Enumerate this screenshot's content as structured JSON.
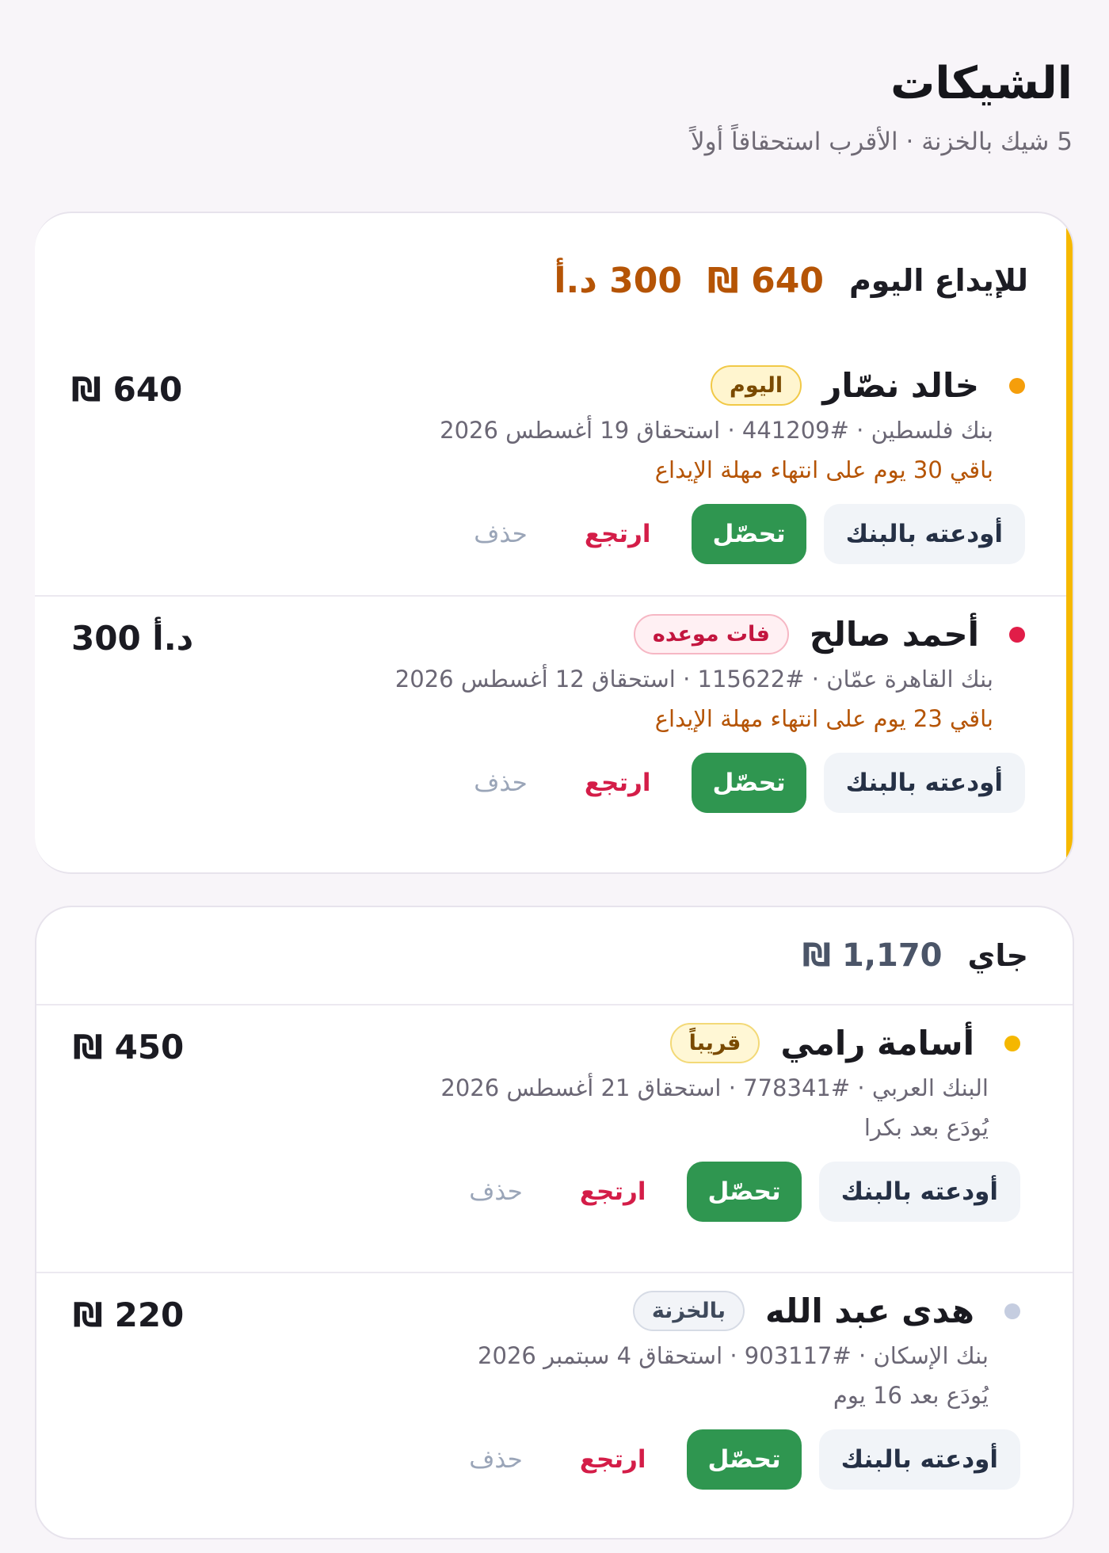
{
  "header": {
    "title": "الشيكات",
    "subtitle": "5 شيك بالخزنة · الأقرب استحقاقاً أولاً"
  },
  "colors": {
    "accent_today": "#f6b800",
    "amount_orange": "#b55405",
    "collect_green": "#2f9650",
    "bounce_red": "#d41d48",
    "dot_orange": "#f59e0b",
    "dot_red": "#e11d48",
    "dot_yellow": "#f5b700",
    "dot_gray": "#c5cde0"
  },
  "actions": {
    "deposit": "أودعته بالبنك",
    "collect": "تحصّل",
    "bounce": "ارتجع",
    "delete": "حذف"
  },
  "today": {
    "label": "للإيداع اليوم",
    "amount_ils": "640 ₪",
    "amount_jod": "300 د.أ",
    "checks": [
      {
        "name": "خالد نصّار",
        "badge": "اليوم",
        "meta": "بنك فلسطين · #441209 · استحقاق 19 أغسطس 2026",
        "note": "باقي 30 يوم على انتهاء مهلة الإيداع",
        "amount": "₪ 640"
      },
      {
        "name": "أحمد صالح",
        "badge": "فات موعده",
        "meta": "بنك القاهرة عمّان · #115622 · استحقاق 12 أغسطس 2026",
        "note": "باقي 23 يوم على انتهاء مهلة الإيداع",
        "amount": "د.أ 300"
      }
    ]
  },
  "upcoming": {
    "label": "جاي",
    "amount": "1,170 ₪",
    "checks": [
      {
        "name": "أسامة رامي",
        "badge": "قريباً",
        "meta": "البنك العربي · #778341 · استحقاق 21 أغسطس 2026",
        "note": "يُودَع بعد بكرا",
        "amount": "₪ 450"
      },
      {
        "name": "هدى عبد الله",
        "badge": "بالخزنة",
        "meta": "بنك الإسكان · #903117 · استحقاق 4 سبتمبر 2026",
        "note": "يُودَع بعد 16 يوم",
        "amount": "₪ 220"
      }
    ]
  }
}
